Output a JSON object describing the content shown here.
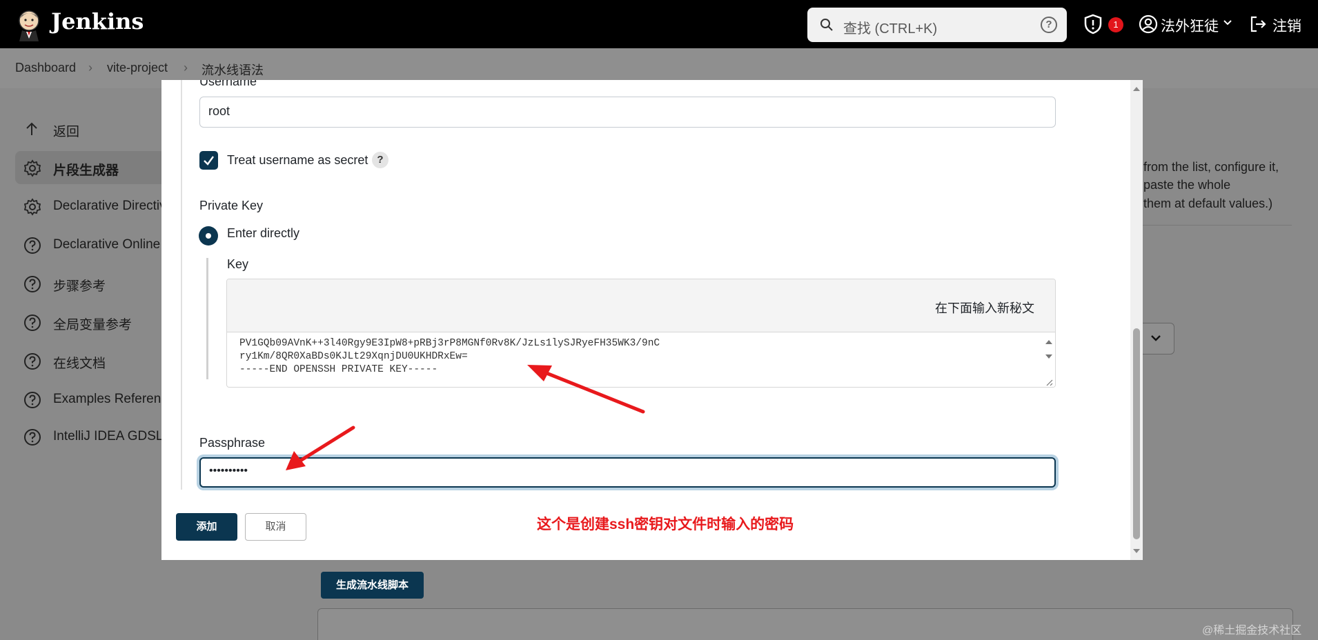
{
  "header": {
    "brand": "Jenkins",
    "search_placeholder": "查找 (CTRL+K)",
    "help_label": "?",
    "notifications_count": "1",
    "user_name": "法外狂徒",
    "logout_label": "注销"
  },
  "breadcrumb": [
    "Dashboard",
    "vite-project",
    "流水线语法"
  ],
  "sidebar": {
    "items": [
      {
        "label": "返回",
        "icon": "arrow-up-icon"
      },
      {
        "label": "片段生成器",
        "icon": "gear-icon",
        "active": true
      },
      {
        "label": "Declarative Directive",
        "icon": "gear-icon"
      },
      {
        "label": "Declarative Online",
        "icon": "help-circle-icon"
      },
      {
        "label": "步骤参考",
        "icon": "help-circle-icon"
      },
      {
        "label": "全局变量参考",
        "icon": "help-circle-icon"
      },
      {
        "label": "在线文档",
        "icon": "help-circle-icon"
      },
      {
        "label": "Examples Reference",
        "icon": "help-circle-icon"
      },
      {
        "label": "IntelliJ IDEA GDSL",
        "icon": "help-circle-icon"
      }
    ]
  },
  "background": {
    "description_lines": [
      "from the list, configure it,",
      "paste the whole",
      "them at default values.)"
    ],
    "generate_button": "生成流水线脚本",
    "watermark": "@稀土掘金技术社区"
  },
  "dialog": {
    "username_label": "Username",
    "username_value": "root",
    "treat_secret_label": "Treat username as secret",
    "treat_secret_checked": true,
    "help_label": "?",
    "private_key_label": "Private Key",
    "enter_directly_label": "Enter directly",
    "key_label": "Key",
    "key_placeholder": "在下面输入新秘文",
    "key_content": "PV1GQb09AVnK++3l40Rgy9E3IpW8+pRBj3rP8MGNf0Rv8K/JzLs1lySJRyeFH35WK3/9nC\nry1Km/8QR0XaBDs0KJLt29XqnjDU0UKHDRxEw=\n-----END OPENSSH PRIVATE KEY-----",
    "passphrase_label": "Passphrase",
    "passphrase_value": "••••••••••",
    "add_button": "添加",
    "cancel_button": "取消"
  },
  "annotation": {
    "text": "这个是创建ssh密钥对文件时输入的密码",
    "color": "#e8191c"
  },
  "colors": {
    "primary": "#0b3650",
    "header_bg": "#000000",
    "badge": "#e2151b"
  }
}
